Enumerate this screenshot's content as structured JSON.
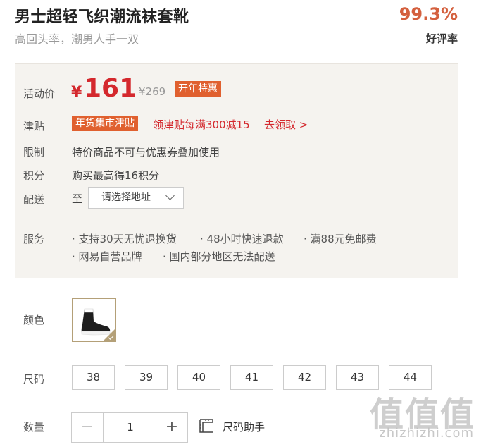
{
  "product": {
    "title": "男士超轻飞织潮流袜套靴",
    "subtitle": "高回头率，潮男人手一双",
    "rating_value": "99.3%",
    "rating_label": "好评率"
  },
  "promo": {
    "price_label": "活动价",
    "currency": "¥",
    "price": "161",
    "original_price": "¥269",
    "price_tag": "开年特惠",
    "subsidy_label": "津贴",
    "subsidy_tag": "年货集市津贴",
    "subsidy_text": "领津贴每满300减15",
    "subsidy_link": "去领取 >",
    "limit_label": "限制",
    "limit_text": "特价商品不可与优惠券叠加使用",
    "points_label": "积分",
    "points_text": "购买最高得16积分",
    "delivery_label": "配送",
    "delivery_to": "至",
    "address_placeholder": "请选择地址",
    "service_label": "服务",
    "services": [
      "· 支持30天无忧退换货",
      "· 48小时快速退款",
      "· 满88元免邮费",
      "· 网易自营品牌",
      "· 国内部分地区无法配送"
    ]
  },
  "options": {
    "color_label": "颜色",
    "size_label": "尺码",
    "sizes": [
      "38",
      "39",
      "40",
      "41",
      "42",
      "43",
      "44"
    ],
    "qty_label": "数量",
    "qty_minus": "−",
    "qty_value": "1",
    "qty_plus": "+",
    "size_helper": "尺码助手"
  },
  "watermark": {
    "logo": "值值值",
    "site": "zhizhizhi.com"
  },
  "colors": {
    "accent_red": "#d4282d",
    "tag_orange": "#e0602f",
    "rating_orange": "#d4603e",
    "panel_bg": "#f5f3ef",
    "swatch_border": "#b4a078"
  }
}
